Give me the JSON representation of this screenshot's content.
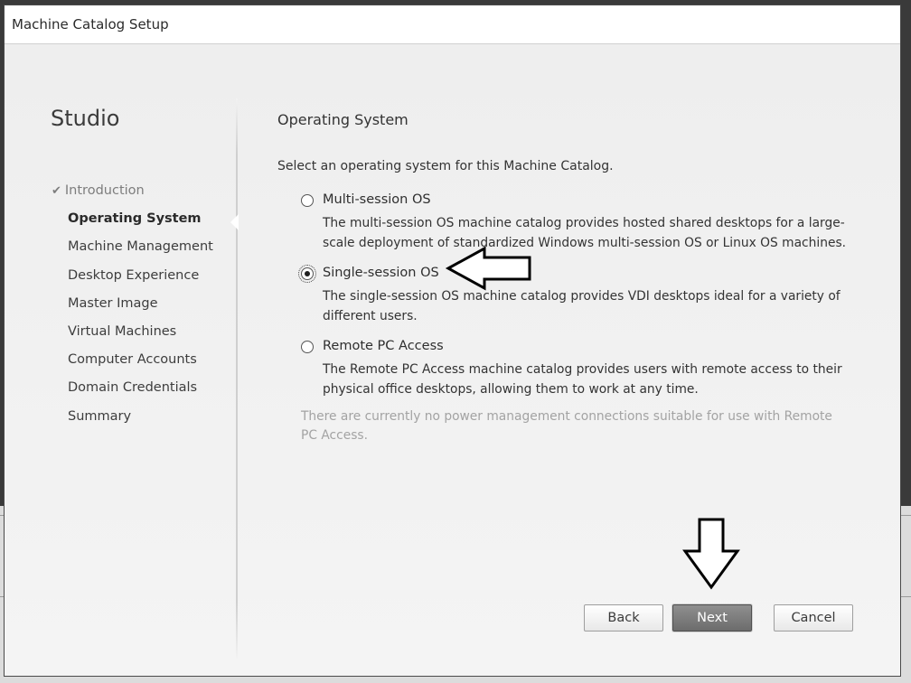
{
  "window": {
    "title": "Machine Catalog Setup"
  },
  "sidebar": {
    "brand": "Studio",
    "items": [
      {
        "label": "Introduction",
        "state": "done"
      },
      {
        "label": "Operating System",
        "state": "current"
      },
      {
        "label": "Machine Management",
        "state": "pending"
      },
      {
        "label": "Desktop Experience",
        "state": "pending"
      },
      {
        "label": "Master Image",
        "state": "pending"
      },
      {
        "label": "Virtual Machines",
        "state": "pending"
      },
      {
        "label": "Computer Accounts",
        "state": "pending"
      },
      {
        "label": "Domain Credentials",
        "state": "pending"
      },
      {
        "label": "Summary",
        "state": "pending"
      }
    ]
  },
  "main": {
    "heading": "Operating System",
    "intro": "Select an operating system for this Machine Catalog.",
    "options": [
      {
        "label": "Multi-session OS",
        "description": "The multi-session OS machine catalog provides hosted shared desktops for a large-scale deployment of standardized Windows multi-session OS or Linux OS machines.",
        "selected": false
      },
      {
        "label": "Single-session OS",
        "description": "The single-session OS machine catalog provides VDI desktops ideal for a variety of different users.",
        "selected": true
      },
      {
        "label": "Remote PC Access",
        "description": "The Remote PC Access machine catalog provides users with remote access to their physical office desktops, allowing them to work at any time.",
        "selected": false
      }
    ],
    "note": "There are currently no power management connections suitable for use with Remote PC Access."
  },
  "buttons": {
    "back": "Back",
    "next": "Next",
    "cancel": "Cancel"
  },
  "icons": {
    "check": "check-icon"
  }
}
